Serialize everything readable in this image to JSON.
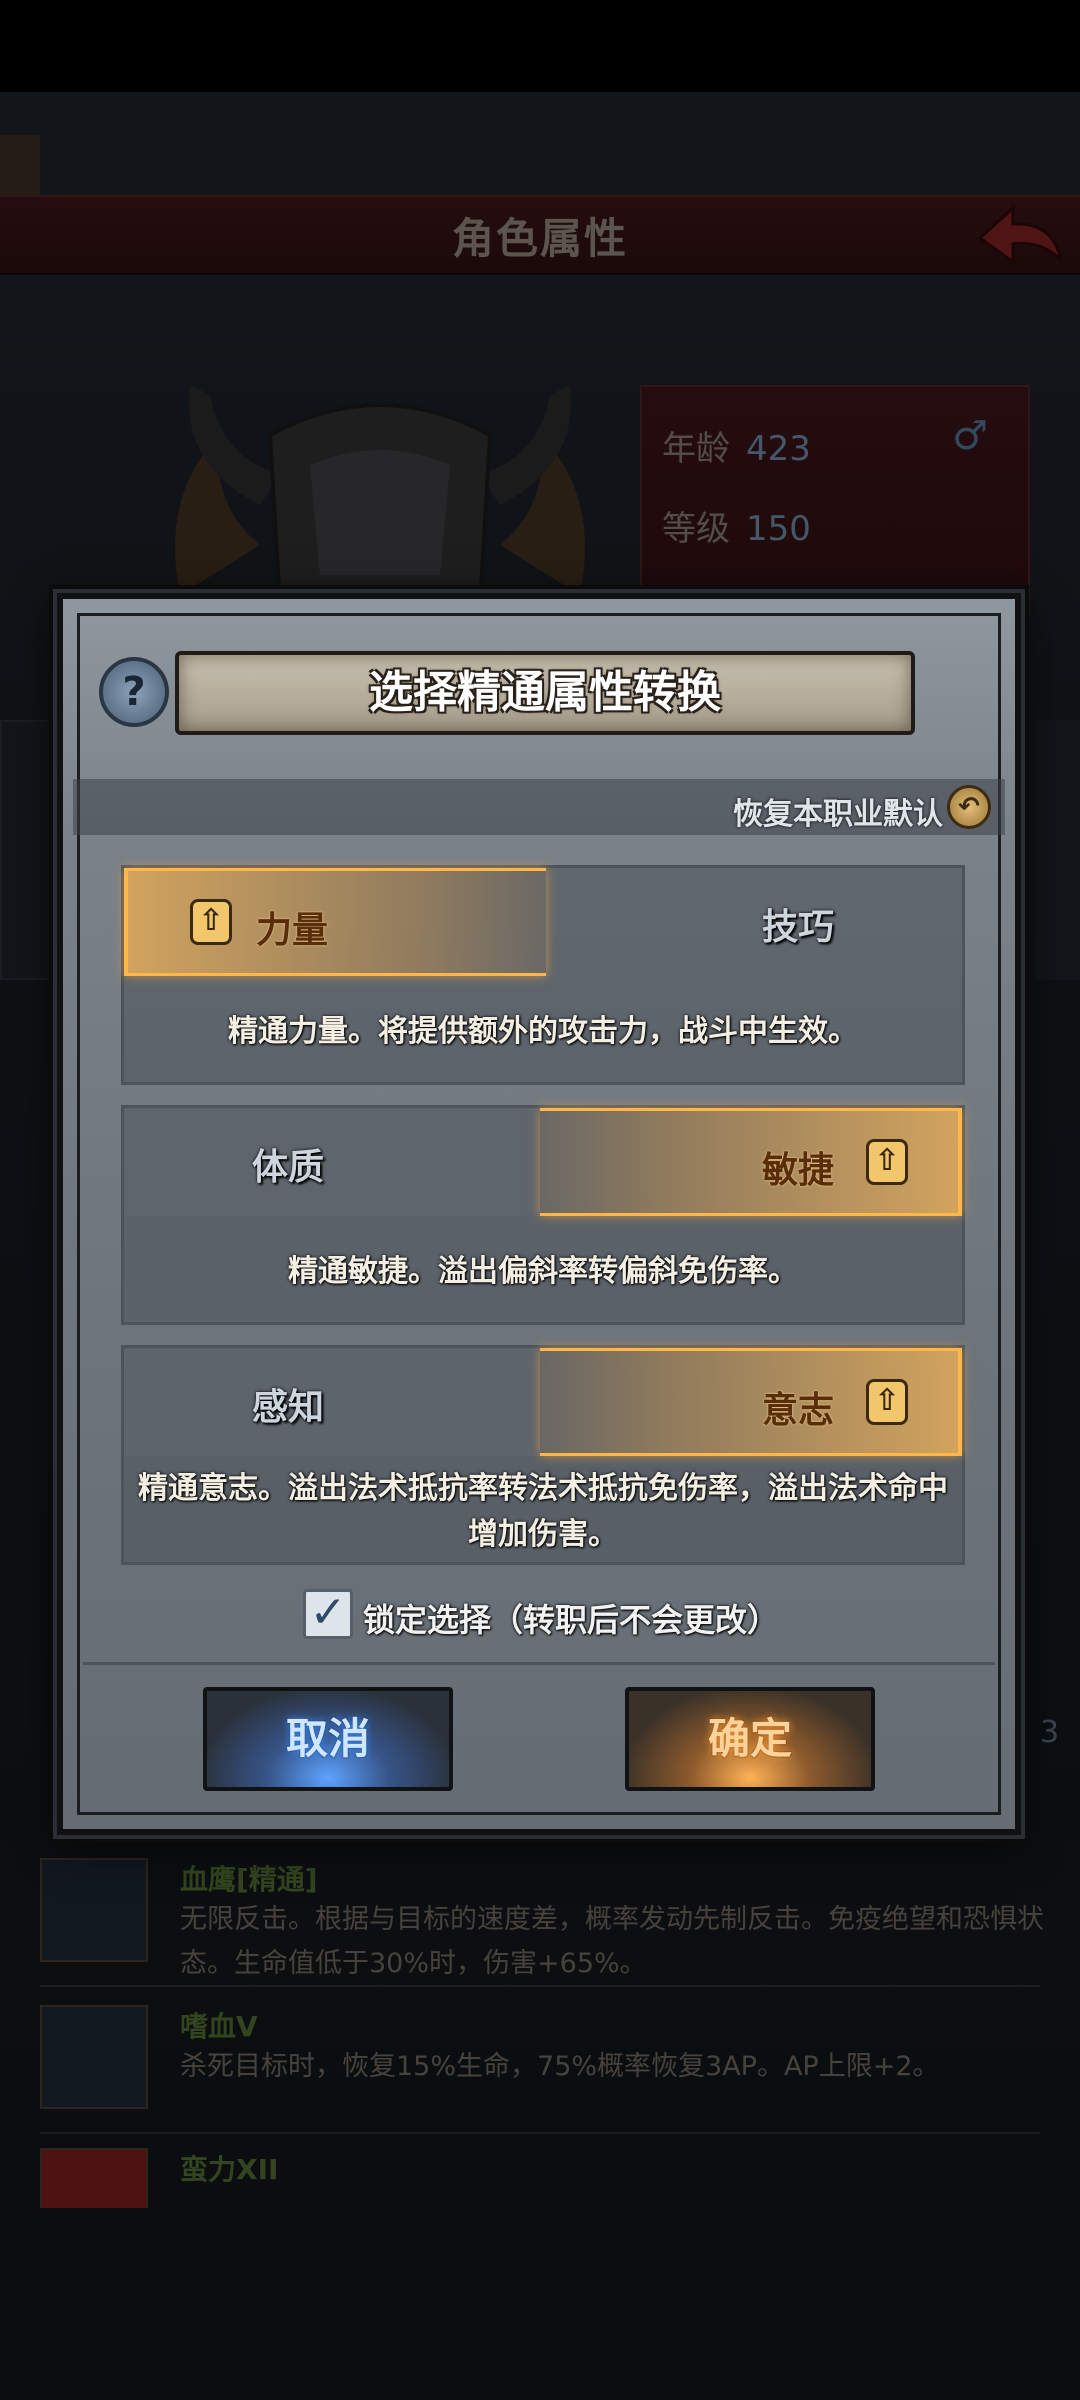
{
  "background": {
    "title": "角色属性",
    "stats": [
      {
        "label": "年龄",
        "value": "423"
      },
      {
        "label": "等级",
        "value": "150"
      }
    ],
    "gender_symbol": "♂",
    "right_number": "3",
    "skills": [
      {
        "name": "血鹰[精通]",
        "desc": "无限反击。根据与目标的速度差，概率发动先制反击。免疫绝望和恐惧状态。生命值低于30%时，伤害+65%。"
      },
      {
        "name": "嗜血V",
        "desc": "杀死目标时，恢复15%生命，75%概率恢复3AP。AP上限+2。"
      },
      {
        "name": "蛮力XII",
        "desc": ""
      }
    ]
  },
  "dialog": {
    "help_icon": "?",
    "title": "选择精通属性转换",
    "restore_label": "恢复本职业默认",
    "restore_icon": "↶",
    "choices": [
      {
        "left": "力量",
        "right": "技巧",
        "selected": "left",
        "desc": "精通力量。将提供额外的攻击力，战斗中生效。"
      },
      {
        "left": "体质",
        "right": "敏捷",
        "selected": "right",
        "desc": "精通敏捷。溢出偏斜率转偏斜免伤率。"
      },
      {
        "left": "感知",
        "right": "意志",
        "selected": "right",
        "desc": "精通意志。溢出法术抵抗率转法术抵抗免伤率，溢出法术命中增加伤害。"
      }
    ],
    "arrow_glyph": "⇧",
    "lock": {
      "checked": true,
      "check_glyph": "✓",
      "label": "锁定选择（转职后不会更改）"
    },
    "cancel_label": "取消",
    "confirm_label": "确定"
  }
}
